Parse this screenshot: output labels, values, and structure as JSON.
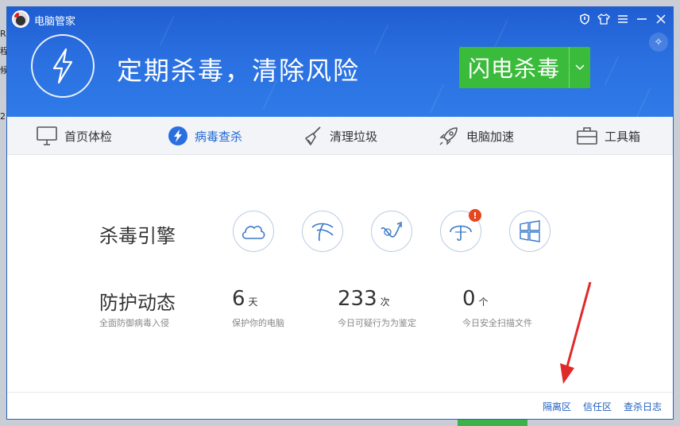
{
  "app": {
    "title": "电脑管家"
  },
  "titlebar": {
    "icons": [
      "shield-icon",
      "shirt-icon",
      "menu-icon",
      "minimize-icon",
      "close-icon"
    ]
  },
  "hero": {
    "slogan": "定期杀毒，清除风险",
    "scan_button": "闪电杀毒"
  },
  "nav": {
    "items": [
      {
        "label": "首页体检",
        "icon": "monitor-icon"
      },
      {
        "label": "病毒查杀",
        "icon": "lightning-icon",
        "active": true
      },
      {
        "label": "清理垃圾",
        "icon": "broom-icon"
      },
      {
        "label": "电脑加速",
        "icon": "rocket-icon"
      },
      {
        "label": "工具箱",
        "icon": "toolbox-icon"
      }
    ]
  },
  "engines": {
    "label": "杀毒引擎",
    "icons": [
      "cloud-icon",
      "wave-icon",
      "curve-arrow-icon",
      "umbrella-icon",
      "windows-icon"
    ],
    "warning_badge": "!"
  },
  "protection": {
    "label": "防护动态",
    "sublabel": "全面防御病毒入侵",
    "stats": [
      {
        "value": "6",
        "unit": "天",
        "caption": "保护你的电脑"
      },
      {
        "value": "233",
        "unit": "次",
        "caption": "今日可疑行为为鉴定"
      },
      {
        "value": "0",
        "unit": "个",
        "caption": "今日安全扫描文件"
      }
    ]
  },
  "footer": {
    "links": [
      "隔离区",
      "信任区",
      "查杀日志"
    ]
  },
  "colors": {
    "header_blue": "#2a6fe0",
    "scan_green": "#3bbb3b",
    "active_blue": "#1e68d4",
    "link_blue": "#1e5fbf",
    "arrow_red": "#e02a2a"
  }
}
